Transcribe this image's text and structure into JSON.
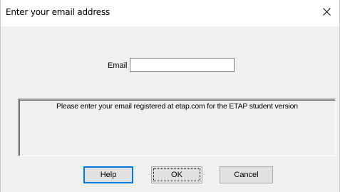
{
  "window": {
    "title": "Enter your email address"
  },
  "form": {
    "email_label": "Email",
    "email_value": ""
  },
  "info": {
    "message": "Please enter your email registered at etap.com for the ETAP student version"
  },
  "buttons": {
    "help": "Help",
    "ok": "OK",
    "cancel": "Cancel"
  },
  "icons": {
    "close": "close-icon"
  },
  "colors": {
    "focus_accent": "#0078d7",
    "dialog_bg": "#f0f0f0",
    "title_bg": "#ffffff"
  }
}
